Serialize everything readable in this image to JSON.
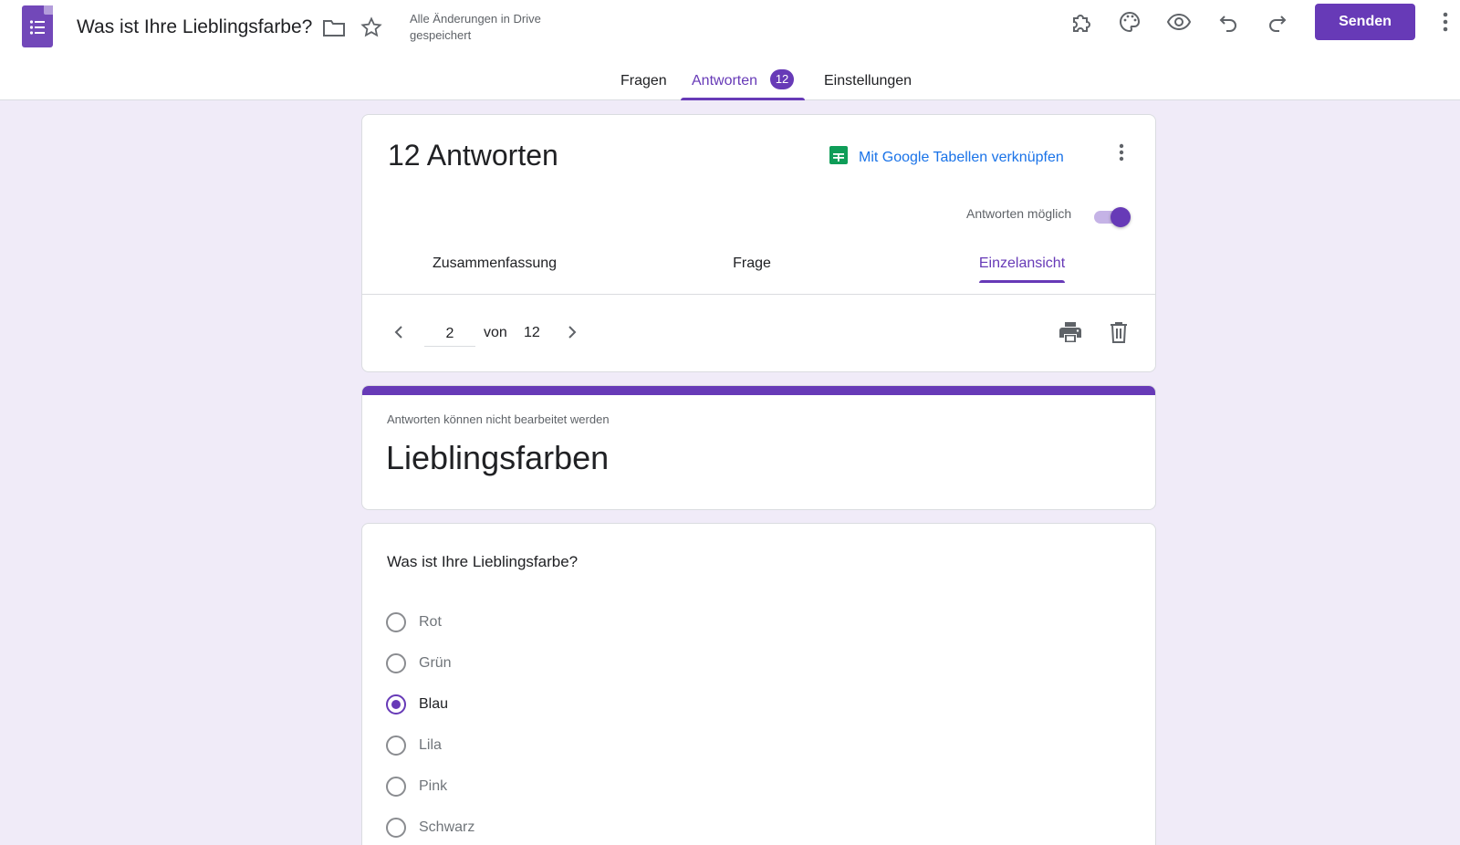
{
  "header": {
    "title": "Was ist Ihre Lieblingsfarbe?",
    "save_status": "Alle Änderungen in Drive gespeichert",
    "send_label": "Senden",
    "icons": [
      "forms-logo-icon",
      "folder-icon",
      "star-icon",
      "addon-icon",
      "palette-icon",
      "preview-eye-icon",
      "undo-icon",
      "redo-icon",
      "more-vert-icon"
    ]
  },
  "main_tabs": [
    {
      "label": "Fragen",
      "active": false
    },
    {
      "label": "Antworten",
      "active": true,
      "badge": "12"
    },
    {
      "label": "Einstellungen",
      "active": false
    }
  ],
  "summary": {
    "responses_title": "12 Antworten",
    "sheets_link": "Mit Google Tabellen verknüpfen",
    "accepting_label": "Antworten möglich",
    "accepting_on": true,
    "sub_tabs": [
      {
        "label": "Zusammenfassung",
        "active": false
      },
      {
        "label": "Frage",
        "active": false
      },
      {
        "label": "Einzelansicht",
        "active": true
      }
    ],
    "pager": {
      "current": "2",
      "of_label": "von",
      "total": "12"
    }
  },
  "form_header": {
    "notice": "Antworten können nicht bearbeitet werden",
    "title": "Lieblingsfarben"
  },
  "question": {
    "text": "Was ist Ihre Lieblingsfarbe?",
    "options": [
      {
        "label": "Rot",
        "selected": false
      },
      {
        "label": "Grün",
        "selected": false
      },
      {
        "label": "Blau",
        "selected": true
      },
      {
        "label": "Lila",
        "selected": false
      },
      {
        "label": "Pink",
        "selected": false
      },
      {
        "label": "Schwarz",
        "selected": false
      }
    ]
  },
  "colors": {
    "accent": "#673ab7",
    "background": "#f0ebf8",
    "link": "#1a73e8",
    "sheets_green": "#0f9d58"
  }
}
